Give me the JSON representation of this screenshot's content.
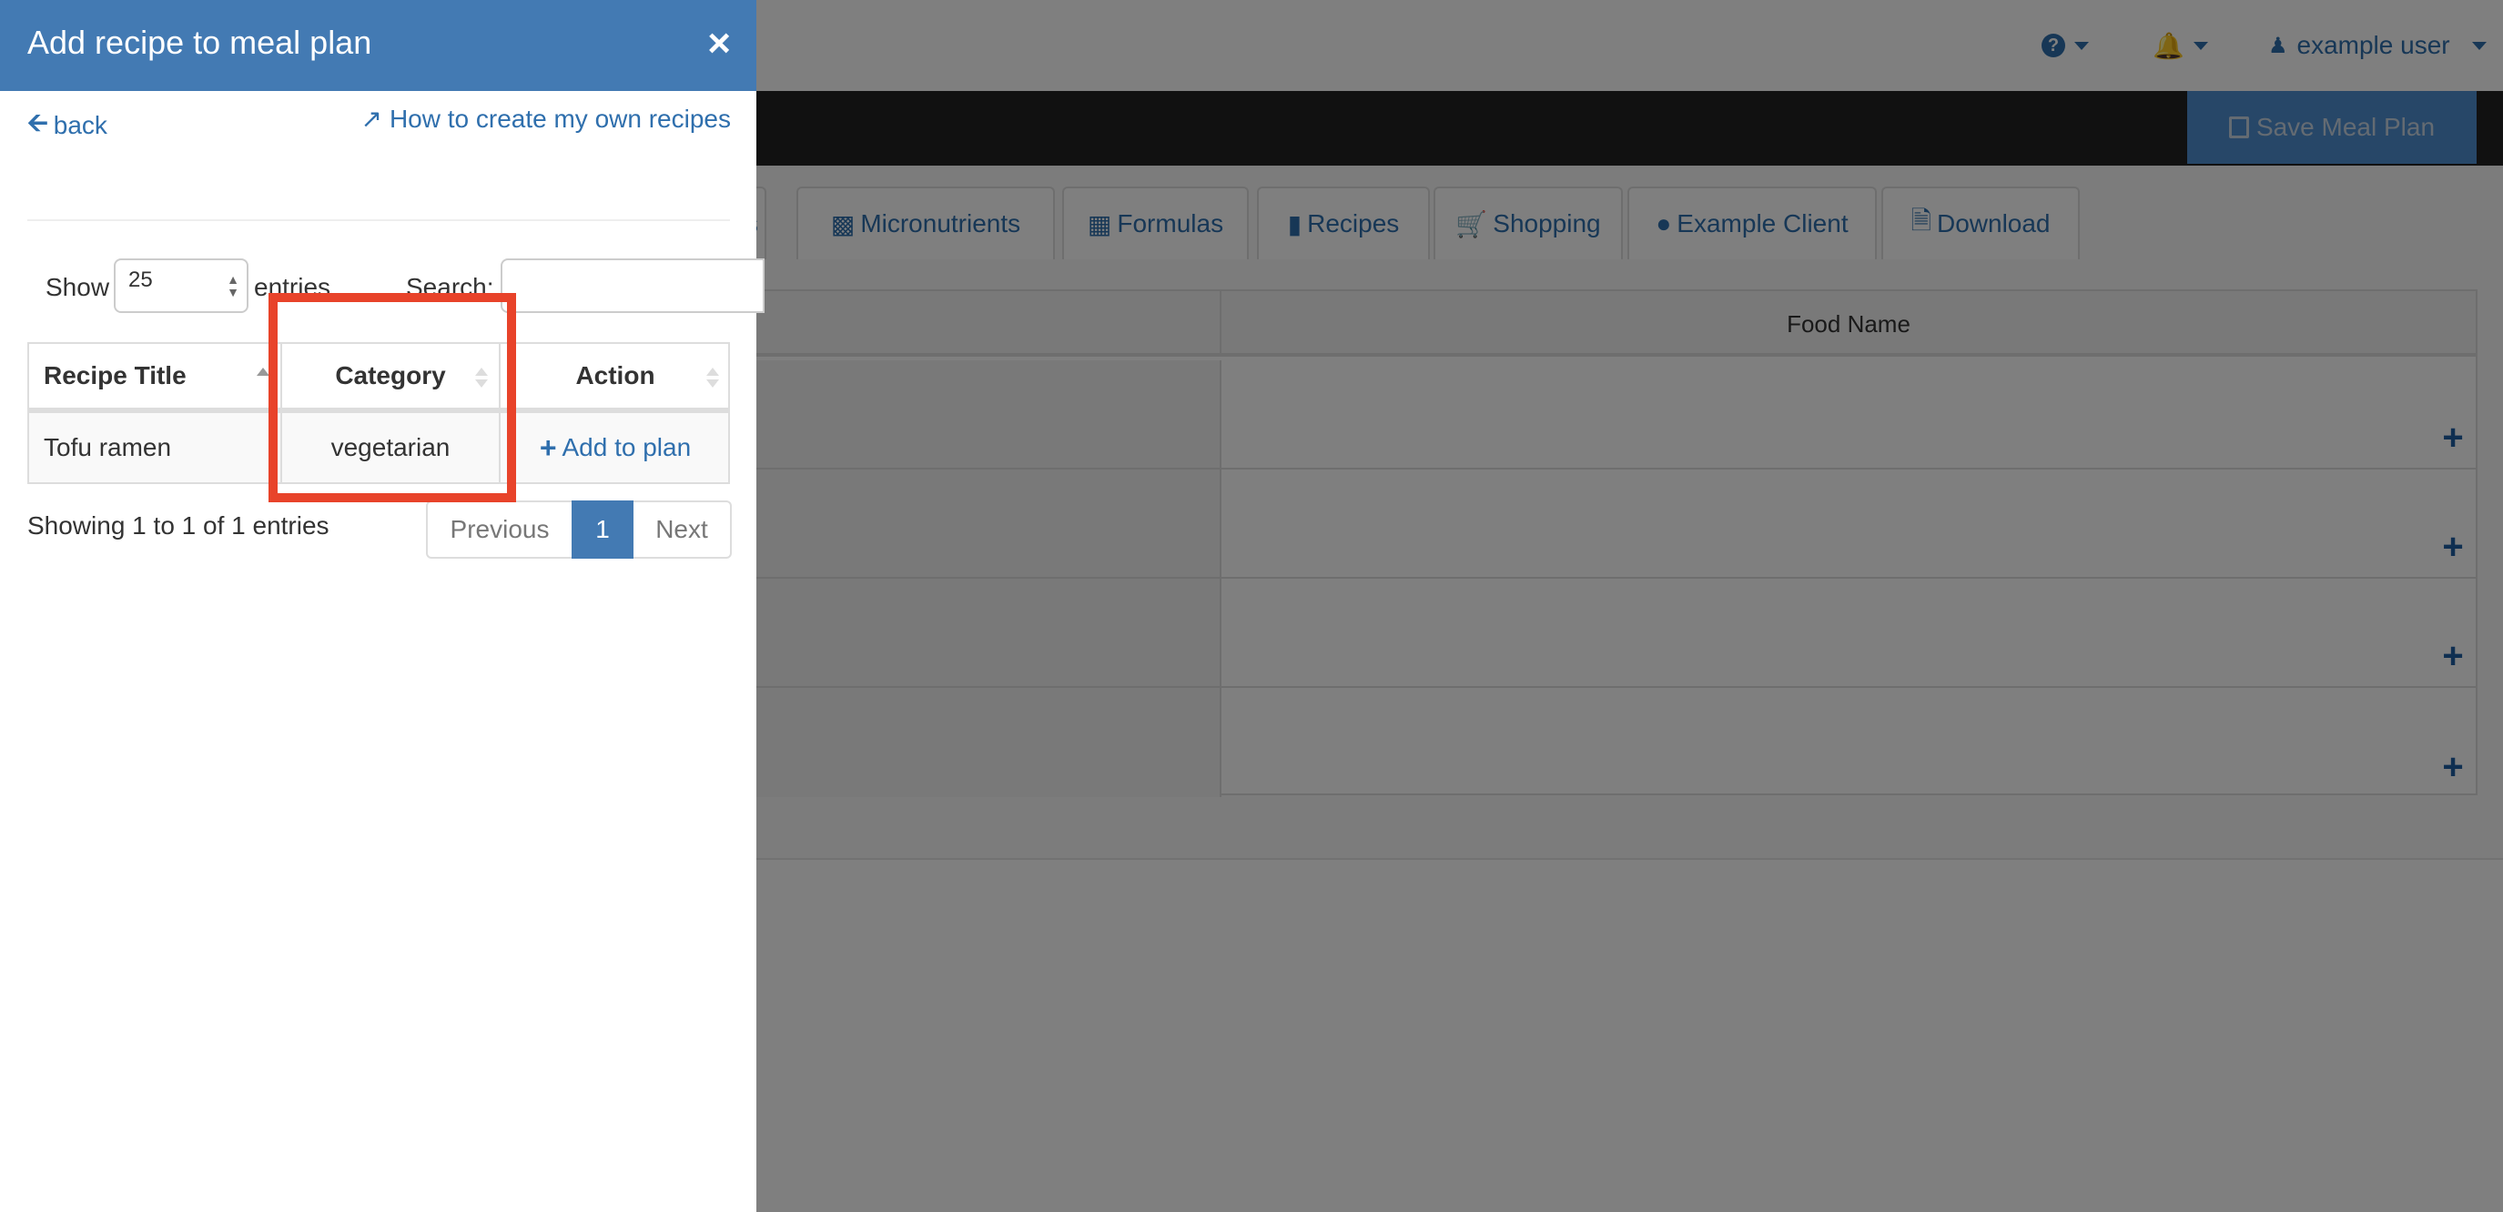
{
  "topbar": {
    "help_icon": "question-circle-icon",
    "bell_icon": "bell-icon",
    "user_icon": "user-md-icon",
    "user_name": "example user"
  },
  "navbar": {
    "save_label": "Save Meal Plan",
    "save_icon": "floppy-disk-icon"
  },
  "tabs": [
    {
      "label": "s",
      "icon": ""
    },
    {
      "label": "Micronutrients",
      "icon": "bar-chart-icon"
    },
    {
      "label": "Formulas",
      "icon": "calculator-icon"
    },
    {
      "label": "Recipes",
      "icon": "book-icon"
    },
    {
      "label": "Shopping",
      "icon": "cart-icon"
    },
    {
      "label": "Example Client",
      "icon": "user-icon"
    },
    {
      "label": "Download",
      "icon": "file-pdf-icon"
    }
  ],
  "main_table": {
    "headers": [
      "",
      "Food Name"
    ],
    "row_count": 4
  },
  "panel": {
    "title": "Add recipe to meal plan",
    "close_symbol": "×",
    "back_label": "back",
    "howto_label": "How to create my own recipes",
    "show_label": "Show",
    "length_value": "25",
    "entries_label": "entries",
    "search_label": "Search:",
    "search_value": "",
    "table": {
      "headers": [
        "Recipe Title",
        "Category",
        "Action"
      ],
      "rows": [
        {
          "title": "Tofu ramen",
          "category": "vegetarian",
          "action": "Add to plan"
        }
      ]
    },
    "info": "Showing 1 to 1 of 1 entries",
    "pagination": {
      "previous": "Previous",
      "current": "1",
      "next": "Next"
    }
  },
  "colors": {
    "accent": "#437ab3",
    "highlight": "#e8432a",
    "navbar": "#222222"
  }
}
